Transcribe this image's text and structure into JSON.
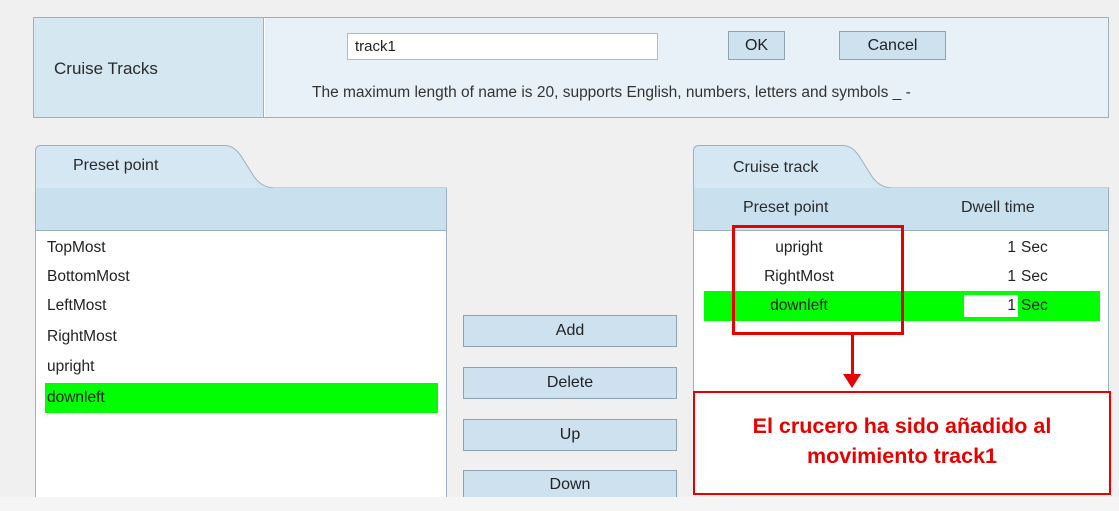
{
  "cruise_tracks": {
    "label": "Cruise Tracks",
    "name_value": "track1",
    "ok_label": "OK",
    "cancel_label": "Cancel",
    "hint": "The maximum length of name is 20, supports English, numbers, letters and symbols _ -"
  },
  "preset_panel": {
    "tab_title": "Preset point",
    "items": [
      {
        "label": "TopMost",
        "selected": false
      },
      {
        "label": "BottomMost",
        "selected": false
      },
      {
        "label": "LeftMost",
        "selected": false
      },
      {
        "label": "RightMost",
        "selected": false
      },
      {
        "label": "upright",
        "selected": false
      },
      {
        "label": "downleft",
        "selected": true
      }
    ]
  },
  "actions": {
    "add_label": "Add",
    "delete_label": "Delete",
    "up_label": "Up",
    "down_label": "Down"
  },
  "cruise_panel": {
    "tab_title": "Cruise track",
    "col_preset": "Preset point",
    "col_dwell": "Dwell time",
    "rows": [
      {
        "point": "upright",
        "dwell": "1",
        "unit": "Sec",
        "selected": false
      },
      {
        "point": "RightMost",
        "dwell": "1",
        "unit": "Sec",
        "selected": false
      },
      {
        "point": "downleft",
        "dwell": "1",
        "unit": "Sec",
        "selected": true
      }
    ]
  },
  "annotation": {
    "line1": "El crucero ha sido añadido al",
    "line2": "movimiento track1",
    "color": "#e60000"
  },
  "colors": {
    "selected": "#00ff00",
    "header_blue": "#c9e0ef"
  }
}
